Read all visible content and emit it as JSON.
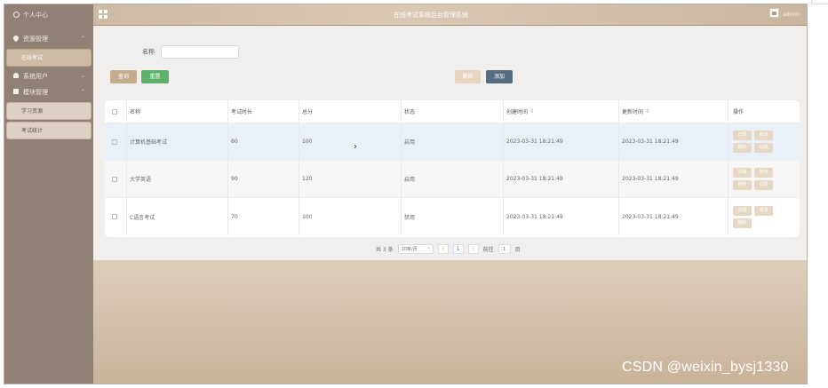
{
  "header": {
    "brand": "个人中心",
    "title": "在线考试系统后台管理系统",
    "user": "admin"
  },
  "sidebar": {
    "items": [
      {
        "label": "资源管理",
        "type": "head"
      },
      {
        "label": "在线考试",
        "type": "sub"
      },
      {
        "label": "系统用户",
        "type": "head"
      },
      {
        "label": "模块管理",
        "type": "head"
      },
      {
        "label": "学习资源",
        "type": "sub"
      },
      {
        "label": "考试统计",
        "type": "sub"
      }
    ]
  },
  "filter": {
    "label": "名称",
    "placeholder": ""
  },
  "buttons": {
    "search": "查询",
    "reset": "重置",
    "delete": "删除",
    "add": "添加"
  },
  "table": {
    "headers": [
      "名称",
      "考试时长",
      "总分",
      "状态",
      "创建时间",
      "更新时间",
      "操作"
    ],
    "rows": [
      {
        "name": "计算机基础考试",
        "duration": "60",
        "total": "100",
        "status": "启用",
        "created": "2023-03-31 18:21:49",
        "updated": "2023-03-31 18:21:49",
        "ops": [
          "详情",
          "修改",
          "删除",
          "试题"
        ]
      },
      {
        "name": "大学英语",
        "duration": "90",
        "total": "120",
        "status": "启用",
        "created": "2023-03-31 18:21:49",
        "updated": "2023-03-31 18:21:49",
        "ops": [
          "详情",
          "修改",
          "删除",
          "试题"
        ]
      },
      {
        "name": "C语言考试",
        "duration": "70",
        "total": "100",
        "status": "禁用",
        "created": "2023-03-31 18:21:49",
        "updated": "2023-03-31 18:21:49",
        "ops": [
          "详情",
          "修改",
          "删除"
        ]
      }
    ]
  },
  "pagination": {
    "total": "共 3 条",
    "page_size": "10条/页",
    "prev": "‹",
    "page": "1",
    "next": "›",
    "goto_label": "前往",
    "goto_value": "1",
    "goto_unit": "页"
  },
  "watermark": "CSDN @weixin_bysj1330"
}
